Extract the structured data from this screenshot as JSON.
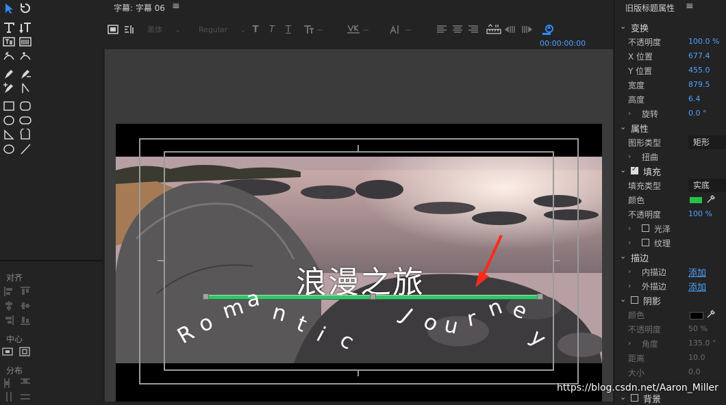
{
  "title_tab": {
    "label": "字幕: 字幕 06",
    "menu": "≡"
  },
  "tools_panel": {
    "align_label": "对齐",
    "center_label": "中心",
    "distribute_label": "分布"
  },
  "toolbar": {
    "font_family": "黑体",
    "font_style": "Regular",
    "timecode": "00:00:00:00"
  },
  "canvas": {
    "title_text": "浪漫之旅",
    "path_text_chars": [
      "R",
      "o",
      "m",
      "a",
      "n",
      "t",
      "i",
      "c",
      "J",
      "o",
      "u",
      "r",
      "n",
      "e",
      "y"
    ]
  },
  "props_panel": {
    "title": "旧版标题属性",
    "menu": "≡",
    "transform": {
      "header": "变换",
      "opacity_label": "不透明度",
      "opacity_value": "100.0 %",
      "x_label": "X 位置",
      "x_value": "677.4",
      "y_label": "Y 位置",
      "y_value": "455.0",
      "width_label": "宽度",
      "width_value": "879.5",
      "height_label": "高度",
      "height_value": "6.4",
      "rotation_label": "旋转",
      "rotation_value": "0.0 °"
    },
    "attributes": {
      "header": "属性",
      "shape_type_label": "图形类型",
      "shape_type_value": "矩形",
      "distort_label": "扭曲"
    },
    "fill": {
      "header": "填充",
      "fill_type_label": "填充类型",
      "fill_type_value": "实底",
      "color_label": "颜色",
      "color_value": "#22c24a",
      "opacity_label": "不透明度",
      "opacity_value": "100 %",
      "gloss_label": "光泽",
      "texture_label": "纹理"
    },
    "stroke": {
      "header": "描边",
      "inner_label": "内描边",
      "inner_action": "添加",
      "outer_label": "外描边",
      "outer_action": "添加"
    },
    "shadow": {
      "header": "阴影",
      "color_label": "颜色",
      "color_value": "#000000",
      "opacity_label": "不透明度",
      "opacity_value": "50 %",
      "angle_label": "角度",
      "angle_value": "135.0 °",
      "distance_label": "距离",
      "distance_value": "10.0",
      "size_label": "大小",
      "size_value": "0.0"
    },
    "background": {
      "header": "背景"
    }
  },
  "annotation": {
    "arrow_color": "#ff2a1a"
  },
  "watermark": "https://blog.csdn.net/Aaron_Miller"
}
